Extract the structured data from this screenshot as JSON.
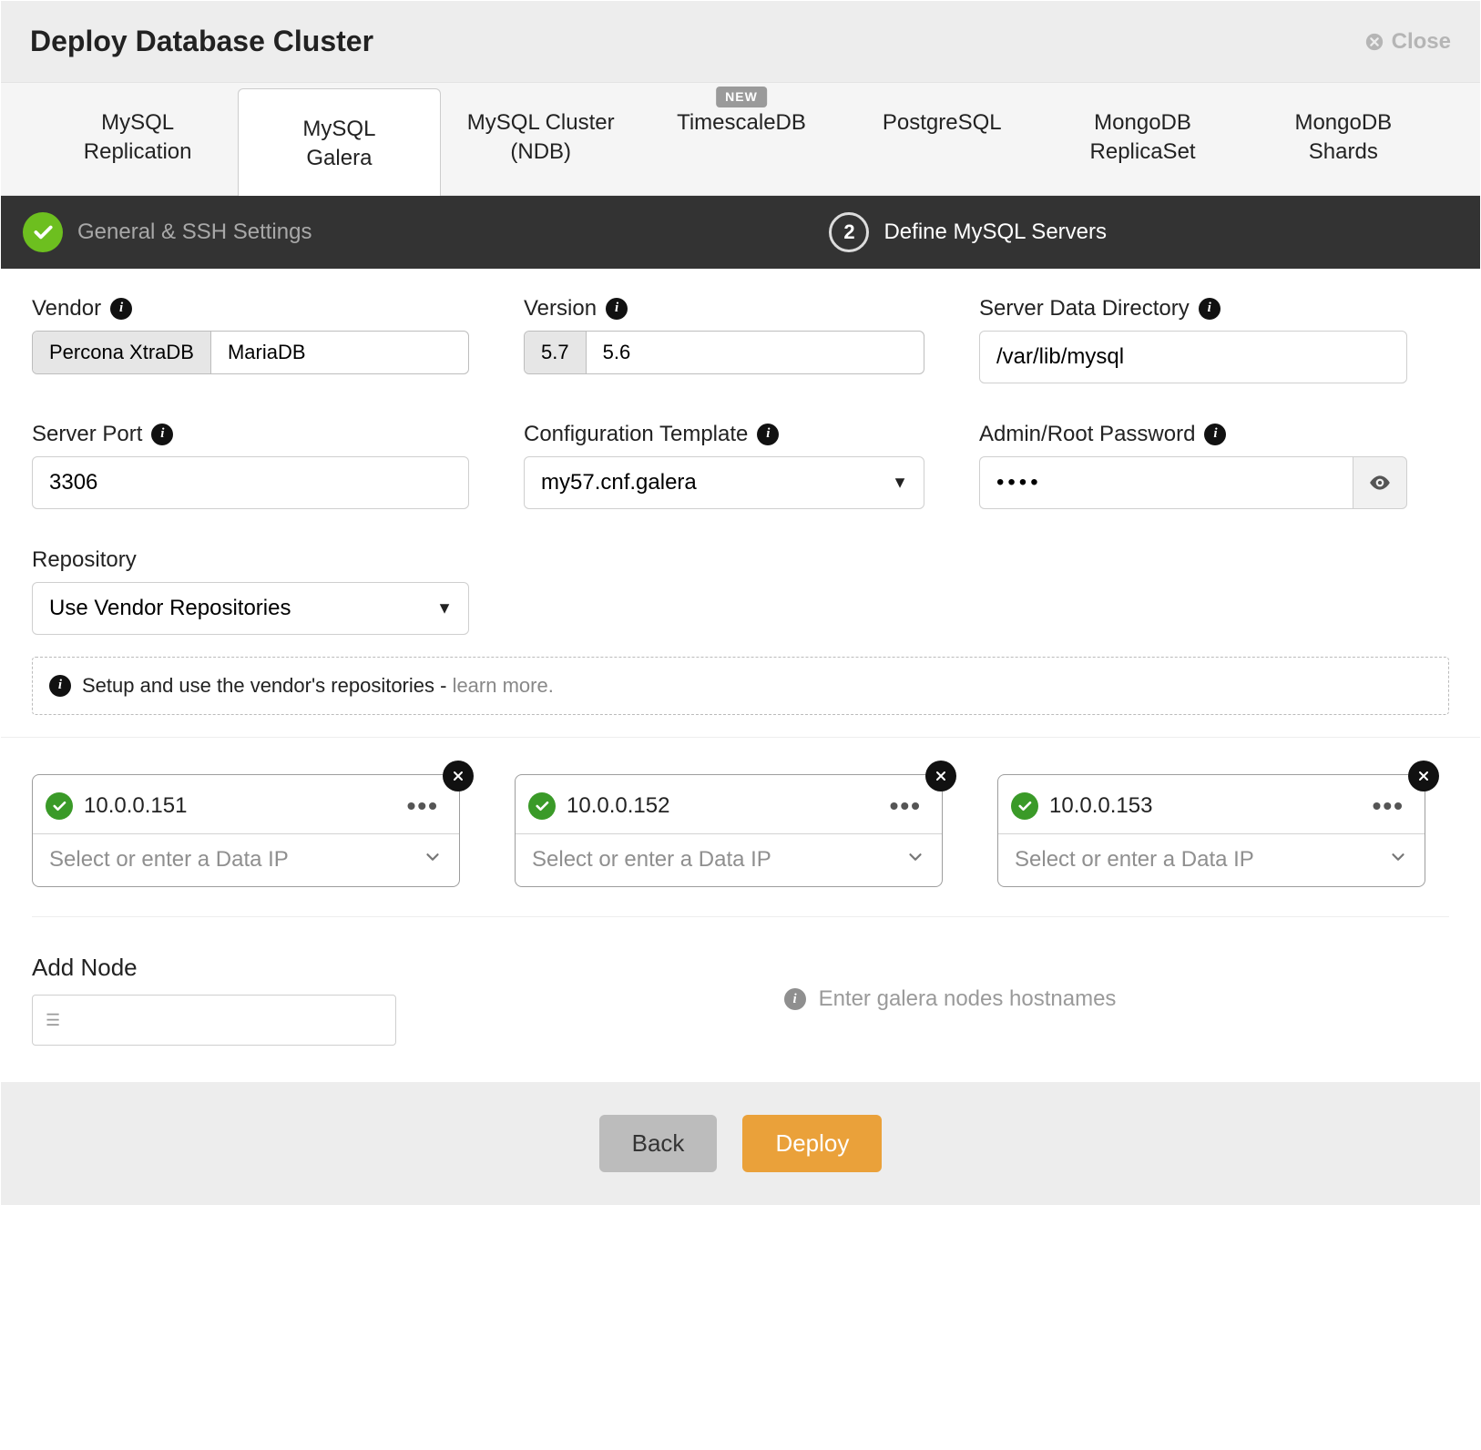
{
  "header": {
    "title": "Deploy Database Cluster",
    "close": "Close"
  },
  "dbTabs": [
    {
      "label": "MySQL\nReplication",
      "badge": null,
      "active": false
    },
    {
      "label": "MySQL\nGalera",
      "badge": null,
      "active": true
    },
    {
      "label": "MySQL Cluster\n(NDB)",
      "badge": null,
      "active": false
    },
    {
      "label": "TimescaleDB",
      "badge": "NEW",
      "active": false
    },
    {
      "label": "PostgreSQL",
      "badge": null,
      "active": false
    },
    {
      "label": "MongoDB\nReplicaSet",
      "badge": null,
      "active": false
    },
    {
      "label": "MongoDB\nShards",
      "badge": null,
      "active": false
    }
  ],
  "steps": {
    "step1": {
      "label": "General & SSH Settings"
    },
    "step2": {
      "number": "2",
      "label": "Define MySQL Servers"
    }
  },
  "form": {
    "vendor": {
      "label": "Vendor",
      "options": [
        "Percona XtraDB",
        "MariaDB"
      ],
      "selectedIndex": 0
    },
    "version": {
      "label": "Version",
      "options": [
        "5.7",
        "5.6"
      ],
      "selectedIndex": 0
    },
    "dataDir": {
      "label": "Server Data Directory",
      "value": "/var/lib/mysql"
    },
    "serverPort": {
      "label": "Server Port",
      "value": "3306"
    },
    "configTemplate": {
      "label": "Configuration Template",
      "value": "my57.cnf.galera"
    },
    "adminPassword": {
      "label": "Admin/Root Password",
      "value": "••••"
    },
    "repository": {
      "label": "Repository",
      "value": "Use Vendor Repositories"
    },
    "repoNote": {
      "text": "Setup and use the vendor's repositories - ",
      "link": "learn more."
    }
  },
  "nodes": [
    {
      "ip": "10.0.0.151",
      "dataIpPlaceholder": "Select or enter a Data IP"
    },
    {
      "ip": "10.0.0.152",
      "dataIpPlaceholder": "Select or enter a Data IP"
    },
    {
      "ip": "10.0.0.153",
      "dataIpPlaceholder": "Select or enter a Data IP"
    }
  ],
  "addNode": {
    "title": "Add Node",
    "hint": "Enter galera nodes hostnames"
  },
  "footer": {
    "back": "Back",
    "deploy": "Deploy"
  }
}
